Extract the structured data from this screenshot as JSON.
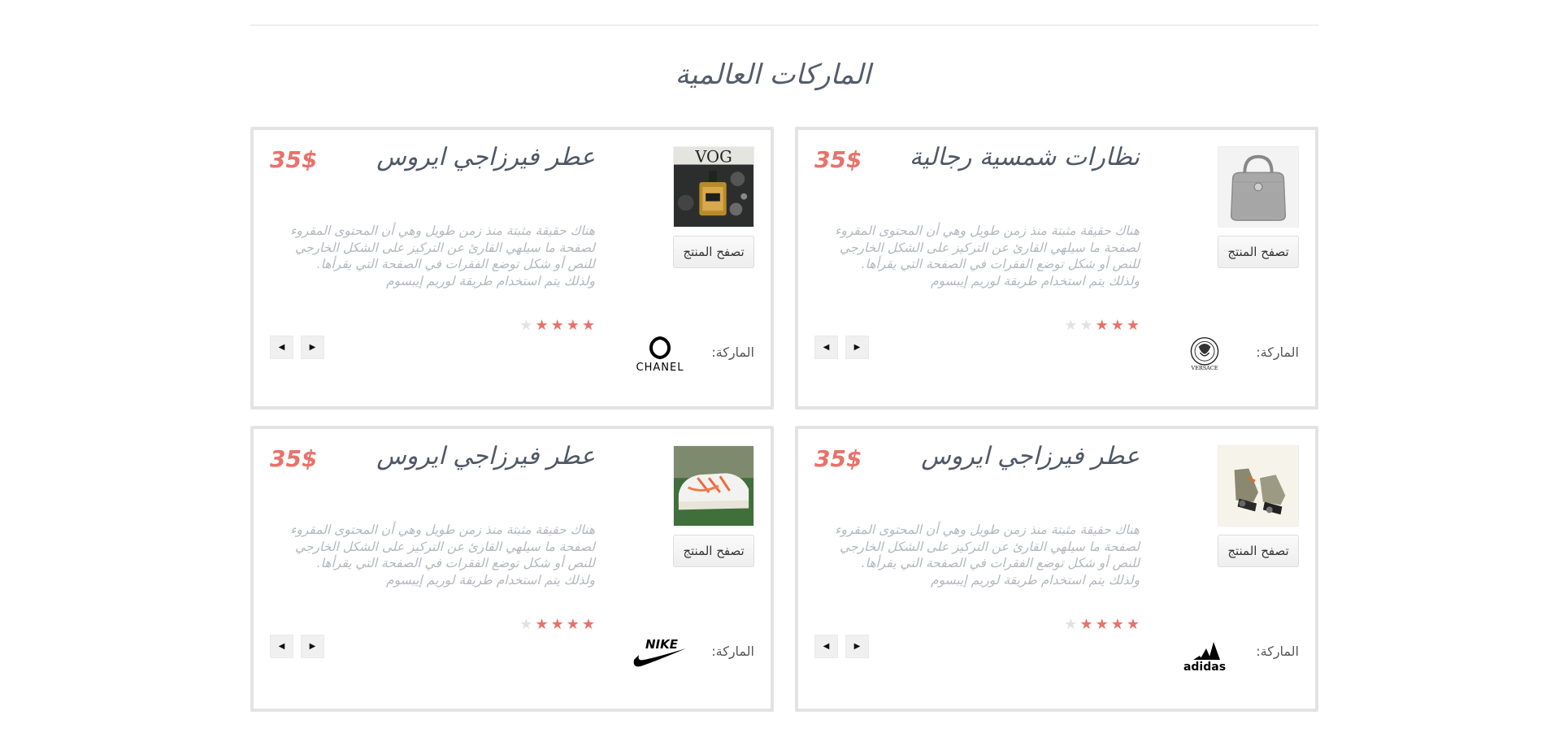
{
  "section": {
    "title": "الماركات العالمية"
  },
  "products": [
    {
      "title": "نظارات شمسية رجالية",
      "price": "35$",
      "description": "هناك حقيقة مثبتة منذ زمن طويل وهي أن المحتوى المقروء لصفحة ما سيلهي القارئ عن التركيز على الشكل الخارجي للنص أو شكل توضع الفقرات في الصفحة التي يقرأها. ولذلك يتم استخدام طريقة لوريم إيبسوم",
      "browse_label": "تصفح المنتج",
      "brand_label": "الماركة:",
      "brand": "VERSACE",
      "rating": 3,
      "rating_max": 5,
      "thumb_icon": "handbag-icon"
    },
    {
      "title": "عطر فيرزاجي ايروس",
      "price": "35$",
      "description": "هناك حقيقة مثبتة منذ زمن طويل وهي أن المحتوى المقروء لصفحة ما سيلهي القارئ عن التركيز على الشكل الخارجي للنص أو شكل توضع الفقرات في الصفحة التي يقرأها. ولذلك يتم استخدام طريقة لوريم إيبسوم",
      "browse_label": "تصفح المنتج",
      "brand_label": "الماركة:",
      "brand": "CHANEL",
      "rating": 4,
      "rating_max": 5,
      "thumb_icon": "perfume-bottle-icon"
    },
    {
      "title": "عطر فيرزاجي ايروس",
      "price": "35$",
      "description": "هناك حقيقة مثبتة منذ زمن طويل وهي أن المحتوى المقروء لصفحة ما سيلهي القارئ عن التركيز على الشكل الخارجي للنص أو شكل توضع الفقرات في الصفحة التي يقرأها. ولذلك يتم استخدام طريقة لوريم إيبسوم",
      "browse_label": "تصفح المنتج",
      "brand_label": "الماركة:",
      "brand": "adidas",
      "rating": 4,
      "rating_max": 5,
      "thumb_icon": "sneakers-icon"
    },
    {
      "title": "عطر فيرزاجي ايروس",
      "price": "35$",
      "description": "هناك حقيقة مثبتة منذ زمن طويل وهي أن المحتوى المقروء لصفحة ما سيلهي القارئ عن التركيز على الشكل الخارجي للنص أو شكل توضع الفقرات في الصفحة التي يقرأها. ولذلك يتم استخدام طريقة لوريم إيبسوم",
      "browse_label": "تصفح المنتج",
      "brand_label": "الماركة:",
      "brand": "NIKE",
      "rating": 4,
      "rating_max": 5,
      "thumb_icon": "shoe-icon"
    }
  ],
  "colors": {
    "accent": "#e8726a",
    "star_off": "#e2e2e2",
    "border": "#e3e3e3"
  }
}
